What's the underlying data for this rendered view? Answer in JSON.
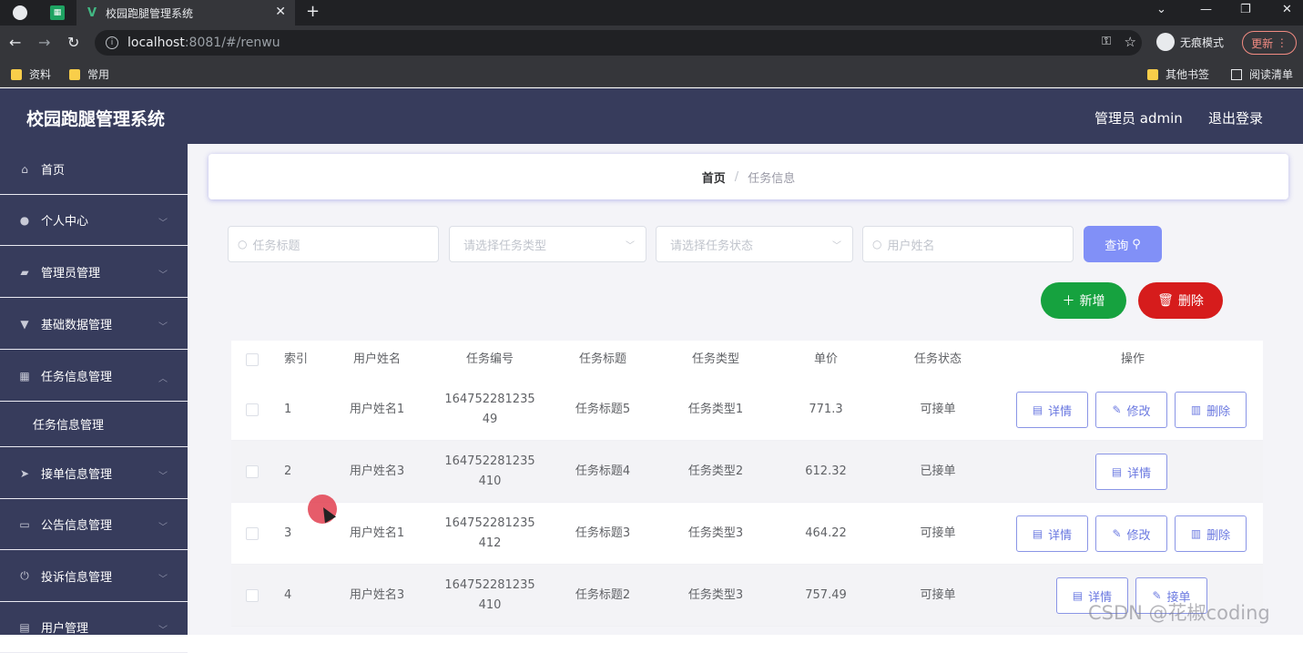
{
  "browser": {
    "tab_title": "校园跑腿管理系统",
    "url_host": "localhost",
    "url_path": ":8081/#/renwu",
    "incognito_label": "无痕模式",
    "update_label": "更新",
    "bookmarks": [
      "资料",
      "常用"
    ],
    "bookmarks_right": [
      "其他书签",
      "阅读清单"
    ]
  },
  "header": {
    "title": "校园跑腿管理系统",
    "admin": "管理员 admin",
    "logout": "退出登录"
  },
  "sidebar": {
    "items": [
      {
        "label": "首页",
        "icon": "home-icon"
      },
      {
        "label": "个人中心",
        "icon": "user-icon"
      },
      {
        "label": "管理员管理",
        "icon": "admin-icon"
      },
      {
        "label": "基础数据管理",
        "icon": "data-icon"
      },
      {
        "label": "任务信息管理",
        "icon": "grid-icon"
      },
      {
        "label": "接单信息管理",
        "icon": "send-icon"
      },
      {
        "label": "公告信息管理",
        "icon": "message-icon"
      },
      {
        "label": "投诉信息管理",
        "icon": "power-icon"
      },
      {
        "label": "用户管理",
        "icon": "doc-icon"
      }
    ],
    "sub_item": "任务信息管理"
  },
  "breadcrumb": {
    "home": "首页",
    "separator": "/",
    "current": "任务信息"
  },
  "filters": {
    "title_placeholder": "任务标题",
    "type_placeholder": "请选择任务类型",
    "status_placeholder": "请选择任务状态",
    "user_placeholder": "用户姓名",
    "query_label": "查询"
  },
  "actions": {
    "add_label": "新增",
    "delete_label": "删除"
  },
  "table": {
    "headers": [
      "索引",
      "用户姓名",
      "任务编号",
      "任务标题",
      "任务类型",
      "单价",
      "任务状态",
      "操作"
    ],
    "rows": [
      {
        "index": "1",
        "user": "用户姓名1",
        "id1": "164752281235",
        "id2": "49",
        "title": "任务标题5",
        "type": "任务类型1",
        "price": "771.3",
        "status": "可接单",
        "ops": [
          "详情",
          "修改",
          "删除"
        ]
      },
      {
        "index": "2",
        "user": "用户姓名3",
        "id1": "164752281235",
        "id2": "410",
        "title": "任务标题4",
        "type": "任务类型2",
        "price": "612.32",
        "status": "已接单",
        "ops": [
          "详情"
        ]
      },
      {
        "index": "3",
        "user": "用户姓名1",
        "id1": "164752281235",
        "id2": "412",
        "title": "任务标题3",
        "type": "任务类型3",
        "price": "464.22",
        "status": "可接单",
        "ops": [
          "详情",
          "修改",
          "删除"
        ]
      },
      {
        "index": "4",
        "user": "用户姓名3",
        "id1": "164752281235",
        "id2": "410",
        "title": "任务标题2",
        "type": "任务类型3",
        "price": "757.49",
        "status": "可接单",
        "ops": [
          "详情",
          "接单"
        ]
      }
    ]
  },
  "watermark": "CSDN @花椒coding",
  "colors": {
    "header": "#373c5c",
    "primary": "#8190f7",
    "success": "#16a23f",
    "danger": "#d61c1c"
  }
}
